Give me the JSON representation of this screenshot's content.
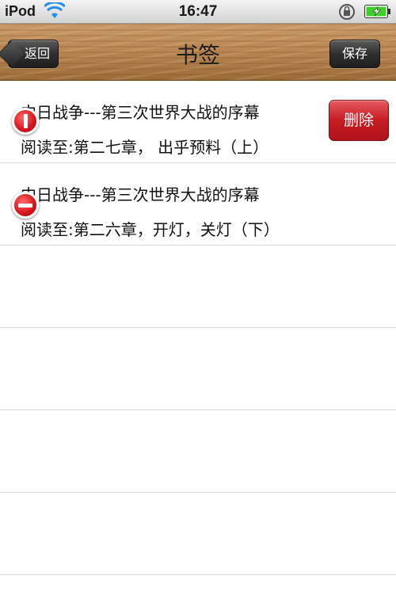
{
  "status_bar": {
    "carrier": "iPod",
    "time": "16:47",
    "icons": [
      "wifi-icon",
      "orientation-lock-icon",
      "battery-charging-icon"
    ],
    "battery_color": "#3fcf2b"
  },
  "nav": {
    "title": "书签",
    "back_label": "返回",
    "save_label": "保存"
  },
  "bookmarks": [
    {
      "title": "中日战争---第三次世界大战的序幕",
      "subtitle": "阅读至:第二七章， 出乎预料（上）",
      "delete_label": "删除",
      "delete_visible": true
    },
    {
      "title": "中日战争---第三次世界大战的序幕",
      "subtitle": "阅读至:第二六章，开灯，关灯（下）",
      "delete_visible": false
    }
  ],
  "colors": {
    "delete_red": "#c81c24",
    "wood": "#b5834f"
  }
}
